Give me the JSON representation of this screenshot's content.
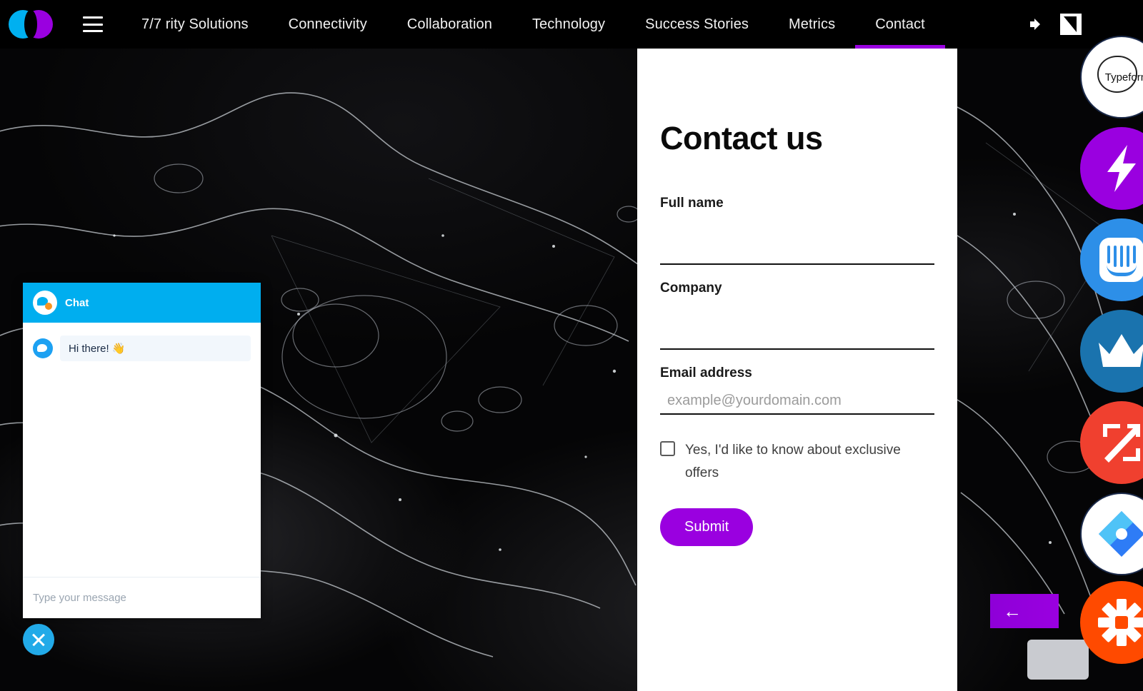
{
  "nav": {
    "logo_name": "brand-logo",
    "menu_icon": "hamburger-menu-icon",
    "brand": "7/7  rity Solutions",
    "items": [
      {
        "label": "Connectivity",
        "active": false
      },
      {
        "label": "Collaboration",
        "active": false
      },
      {
        "label": "Technology",
        "active": false
      },
      {
        "label": "Success Stories",
        "active": false
      },
      {
        "label": "Metrics",
        "active": false
      },
      {
        "label": "Contact",
        "active": true
      }
    ],
    "right_icons": [
      {
        "name": "speaker-icon"
      },
      {
        "name": "window-icon"
      }
    ],
    "active_underline_color": "#9A00E0"
  },
  "form": {
    "title": "Contact us",
    "fields": [
      {
        "label": "Full name",
        "value": "",
        "placeholder": ""
      },
      {
        "label": "Company",
        "value": "",
        "placeholder": ""
      },
      {
        "label": "Email address",
        "value": "",
        "placeholder": "example@yourdomain.com"
      }
    ],
    "checkbox_label": "Yes, I'd like to know about exclusive offers",
    "checkbox_checked": false,
    "submit_label": "Submit",
    "submit_color": "#9A00E0",
    "panel_bg": "#ffffff"
  },
  "chat": {
    "header_title": "Chat",
    "header_color": "#00AEEF",
    "avatar_icon": "chat-bird-avatar-icon",
    "messages": [
      {
        "sender_icon": "bot-avatar-icon",
        "text": "Hi there! 👋"
      }
    ],
    "input_placeholder": "Type your message",
    "close_icon": "close-icon",
    "close_button_color": "#22AAE8"
  },
  "rail": {
    "items": [
      {
        "name": "typeform-app-icon",
        "label": "Typeform",
        "color": "#ffffff"
      },
      {
        "name": "zapier-bolt-app-icon",
        "label": "",
        "color": "#9A00E0"
      },
      {
        "name": "intercom-app-icon",
        "label": "",
        "color": "#2D8FE8"
      },
      {
        "name": "crown-app-icon",
        "label": "",
        "color": "#1A73AE"
      },
      {
        "name": "zoominfo-app-icon",
        "label": "",
        "color": "#F0402F"
      },
      {
        "name": "jira-app-icon",
        "label": "",
        "color": "#ffffff"
      },
      {
        "name": "zapier-app-icon",
        "label": "",
        "color": "#FF4A00"
      }
    ],
    "back_arrow": "←",
    "back_arrow_color": "#9A00E0"
  },
  "background": {
    "description": "dark abstract topographic wireframe",
    "base_color": "#050506",
    "line_color": "#cfd4da"
  }
}
